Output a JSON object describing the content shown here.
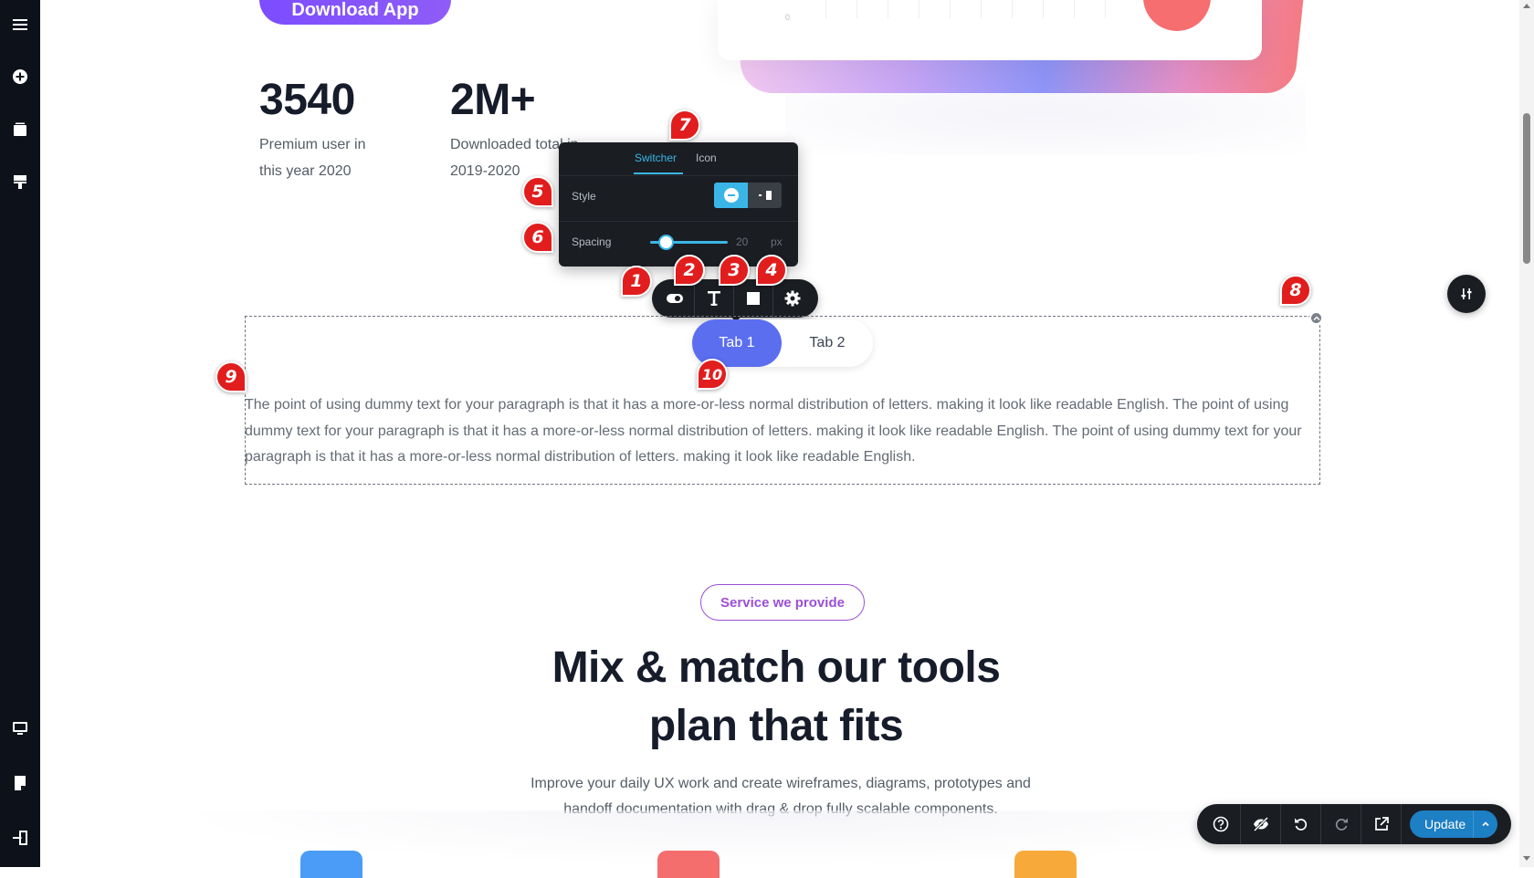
{
  "hero": {
    "download_label": "Download App",
    "chart_zero": "0"
  },
  "stats": [
    {
      "number": "3540",
      "desc_line1": "Premium user in",
      "desc_line2": "this year 2020"
    },
    {
      "number": "2M+",
      "desc_line1": "Downloaded total in",
      "desc_line2": "2019-2020"
    }
  ],
  "popup": {
    "tabs": [
      "Switcher",
      "Icon"
    ],
    "style_label": "Style",
    "spacing_label": "Spacing",
    "spacing_value": "20",
    "spacing_unit": "px",
    "spacing_fraction": 0.2
  },
  "toolbar": {
    "icons": [
      "toggle-icon",
      "text-icon",
      "square-icon",
      "gear-icon"
    ]
  },
  "tabs_widget": {
    "tab1": "Tab 1",
    "tab2": "Tab 2",
    "content": "The point of using dummy text for your paragraph is that it has a more-or-less normal distribution of letters. making it look like readable English. The point of using dummy text for your paragraph is that it has a more-or-less normal distribution of letters. making it look like readable English. The point of using dummy text for your paragraph is that it has a more-or-less normal distribution of letters. making it look like readable English."
  },
  "services": {
    "pill": "Service we provide",
    "heading_line1": "Mix & match our tools",
    "heading_line2": "plan that fits",
    "sub_line1": "Improve your daily UX work and create wireframes, diagrams, prototypes and",
    "sub_line2": "handoff documentation with drag & drop fully scalable components.",
    "card_colors": [
      "#4a9cf7",
      "#f46e6e",
      "#f7a93a"
    ]
  },
  "bottombar": {
    "update_label": "Update",
    "icons": [
      "help-icon",
      "hide-icon",
      "undo-icon",
      "redo-icon",
      "external-link-icon"
    ]
  },
  "markers": [
    "1",
    "2",
    "3",
    "4",
    "5",
    "6",
    "7",
    "8",
    "9",
    "10"
  ],
  "colors": {
    "accent": "#3ab6e6",
    "tab_active": "#5b6ef0",
    "marker": "#e11d1d",
    "update": "#1d7fc4"
  }
}
